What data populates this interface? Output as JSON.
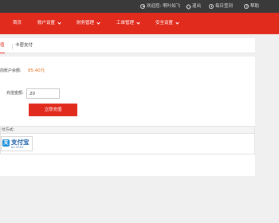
{
  "topbar": {
    "welcome": "欢迎您: 啊叶如飞",
    "logout": "退出",
    "checkin": "每日签到",
    "help": "帮助"
  },
  "nav": {
    "home": "首页",
    "account_settings": "账户设置",
    "finance": "财务管理",
    "tickets": "工单管理",
    "security": "安全设置"
  },
  "tabs": {
    "active": "值",
    "card": "卡密支付"
  },
  "recharge": {
    "balance_label": "前账户余额:",
    "balance_value": "85.40元",
    "amount_label": "充值金额:",
    "amount_value": "20",
    "submit": "立即充值",
    "pay_method_label": "付方式:",
    "alipay_cn": "支付宝",
    "alipay_en": "ALIPAY"
  },
  "colors": {
    "brand_red": "#e12b1d",
    "topbar": "#3a3a3a",
    "balance_orange": "#e8731f",
    "alipay_blue": "#1a8fd8"
  }
}
